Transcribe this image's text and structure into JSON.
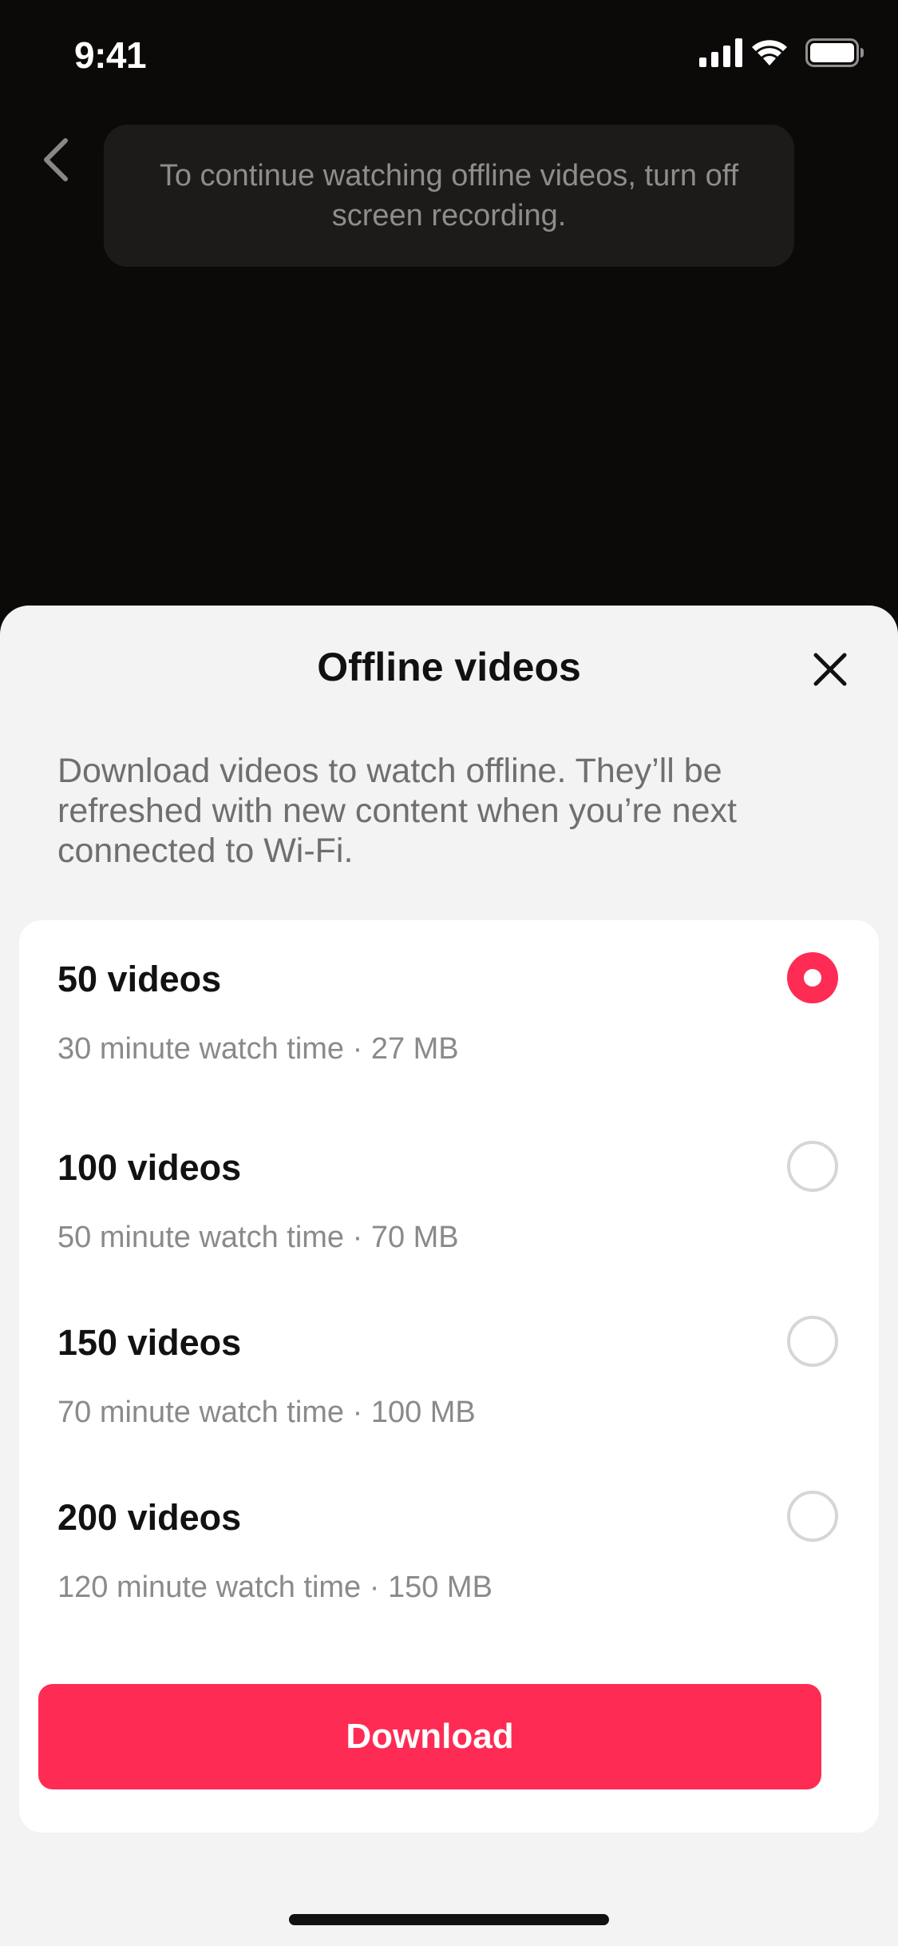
{
  "status_bar": {
    "time": "9:41",
    "icons": [
      "signal-icon",
      "wifi-icon",
      "battery-icon"
    ]
  },
  "video_area": {
    "back_icon": "chevron-left-icon",
    "toast": "To continue watching offline videos, turn off screen recording."
  },
  "sheet": {
    "title": "Offline videos",
    "close_icon": "close-icon",
    "description": "Download videos to watch offline. They’ll be refreshed with new content when you’re next connected to Wi-Fi.",
    "options": [
      {
        "label": "50 videos",
        "detail": "30 minute watch time · 27 MB",
        "selected": true
      },
      {
        "label": "100 videos",
        "detail": "50 minute watch time · 70 MB",
        "selected": false
      },
      {
        "label": "150 videos",
        "detail": "70 minute watch time · 100 MB",
        "selected": false
      },
      {
        "label": "200 videos",
        "detail": "120 minute watch time · 150 MB",
        "selected": false
      }
    ],
    "download_label": "Download"
  },
  "colors": {
    "accent": "#fe2c55",
    "sheet_bg": "#f3f3f3",
    "video_bg": "#0c0a08"
  }
}
